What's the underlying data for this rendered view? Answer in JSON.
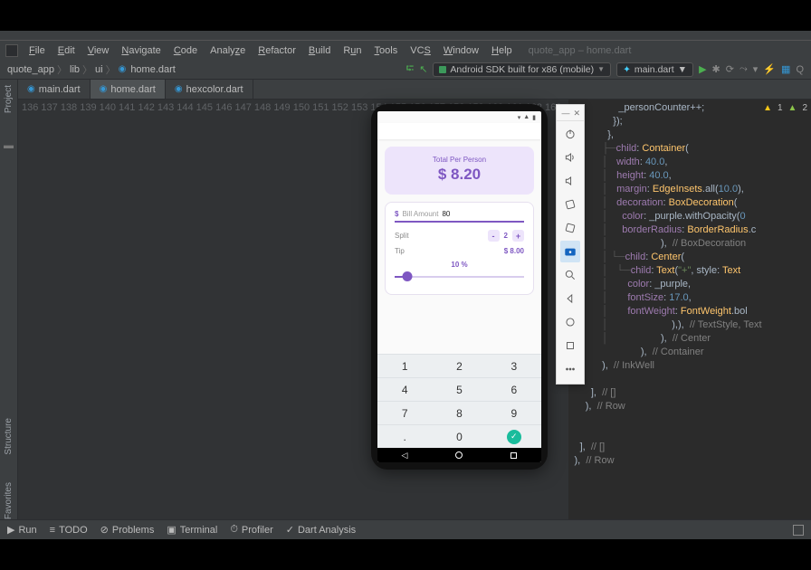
{
  "menu": {
    "items": [
      "File",
      "Edit",
      "View",
      "Navigate",
      "Code",
      "Analyze",
      "Refactor",
      "Build",
      "Run",
      "Tools",
      "VCS",
      "Window",
      "Help"
    ],
    "title": "quote_app – home.dart"
  },
  "breadcrumb": {
    "project": "quote_app",
    "folder1": "lib",
    "folder2": "ui",
    "file": "home.dart"
  },
  "toolbar": {
    "device": "Android SDK built for x86 (mobile)",
    "config": "main.dart"
  },
  "tabs": [
    {
      "label": "main.dart",
      "active": false
    },
    {
      "label": "home.dart",
      "active": true
    },
    {
      "label": "hexcolor.dart",
      "active": false
    }
  ],
  "gutter_tools": [
    "Project",
    "Structure",
    "Favorites"
  ],
  "lines": {
    "start": 136,
    "end": 163
  },
  "code": {
    "l136": "                  _personCounter++;",
    "l137": "                });",
    "l138": "              },",
    "l139a": "              child",
    "l139b": ": ",
    "l139c": "Container",
    "l139d": "(",
    "l140a": "                width",
    "l140b": ": ",
    "l140c": "40.0",
    "l140d": ",",
    "l141a": "                height",
    "l141b": ": ",
    "l141c": "40.0",
    "l141d": ",",
    "l142a": "                margin",
    "l142b": ": ",
    "l142c": "EdgeInsets",
    "l142d": ".all(",
    "l142e": "10.0",
    "l142f": "),",
    "l143a": "                decoration",
    "l143b": ": ",
    "l143c": "BoxDecoration",
    "l143d": "(",
    "l144a": "                  color",
    "l144b": ": _purple.withOpacity(",
    "l144c": "0",
    "l145a": "                  borderRadius",
    "l145b": ": ",
    "l145c": "BorderRadius",
    "l145d": ".c",
    "l146a": "                ),  ",
    "l146b": "// BoxDecoration",
    "l147a": "                child",
    "l147b": ": ",
    "l147c": "Center",
    "l147d": "(",
    "l148a": "                  child",
    "l148b": ": ",
    "l148c": "Text",
    "l148d": "(",
    "l148e": "\"+\"",
    "l148f": ", style: ",
    "l148g": "Text",
    "l149a": "                    color",
    "l149b": ": _purple,",
    "l150a": "                    fontSize",
    "l150b": ": ",
    "l150c": "17.0",
    "l150d": ",",
    "l151a": "                    fontWeight",
    "l151b": ": ",
    "l151c": "FontWeight",
    "l151d": ".bol",
    "l152a": "                  ),),  ",
    "l152b": "// TextStyle, Text",
    "l153a": "                ),  ",
    "l153b": "// Center",
    "l154a": "              ),  ",
    "l154b": "// Container",
    "l155a": "            ),  ",
    "l155b": "// InkWell",
    "l157a": "        ],  ",
    "l157b": "// <Widget>[]",
    "l158a": "      ),  ",
    "l158b": "// Row",
    "l161a": "    ],  ",
    "l161b": "// <Widget>[]",
    "l162a": "  ),  ",
    "l162b": "// Row"
  },
  "warnings": {
    "yellow": "1",
    "green": "2"
  },
  "bottom": {
    "run": "Run",
    "todo": "TODO",
    "problems": "Problems",
    "terminal": "Terminal",
    "profiler": "Profiler",
    "dart": "Dart Analysis"
  },
  "app": {
    "total_label": "Total Per Person",
    "total_amount": "$ 8.20",
    "bill_currency": "$",
    "bill_placeholder": "Bill Amount",
    "bill_value": "80",
    "split_label": "Split",
    "split_value": "2",
    "tip_label": "Tip",
    "tip_value": "$ 8.00",
    "tip_pct": "10 %",
    "keys": [
      "1",
      "2",
      "3",
      "4",
      "5",
      "6",
      "7",
      "8",
      "9",
      ".",
      "0"
    ]
  },
  "emu_controls": [
    "power",
    "vol-up",
    "vol-down",
    "rotate-left",
    "rotate-right",
    "camera",
    "zoom",
    "back",
    "home",
    "overview",
    "more"
  ]
}
